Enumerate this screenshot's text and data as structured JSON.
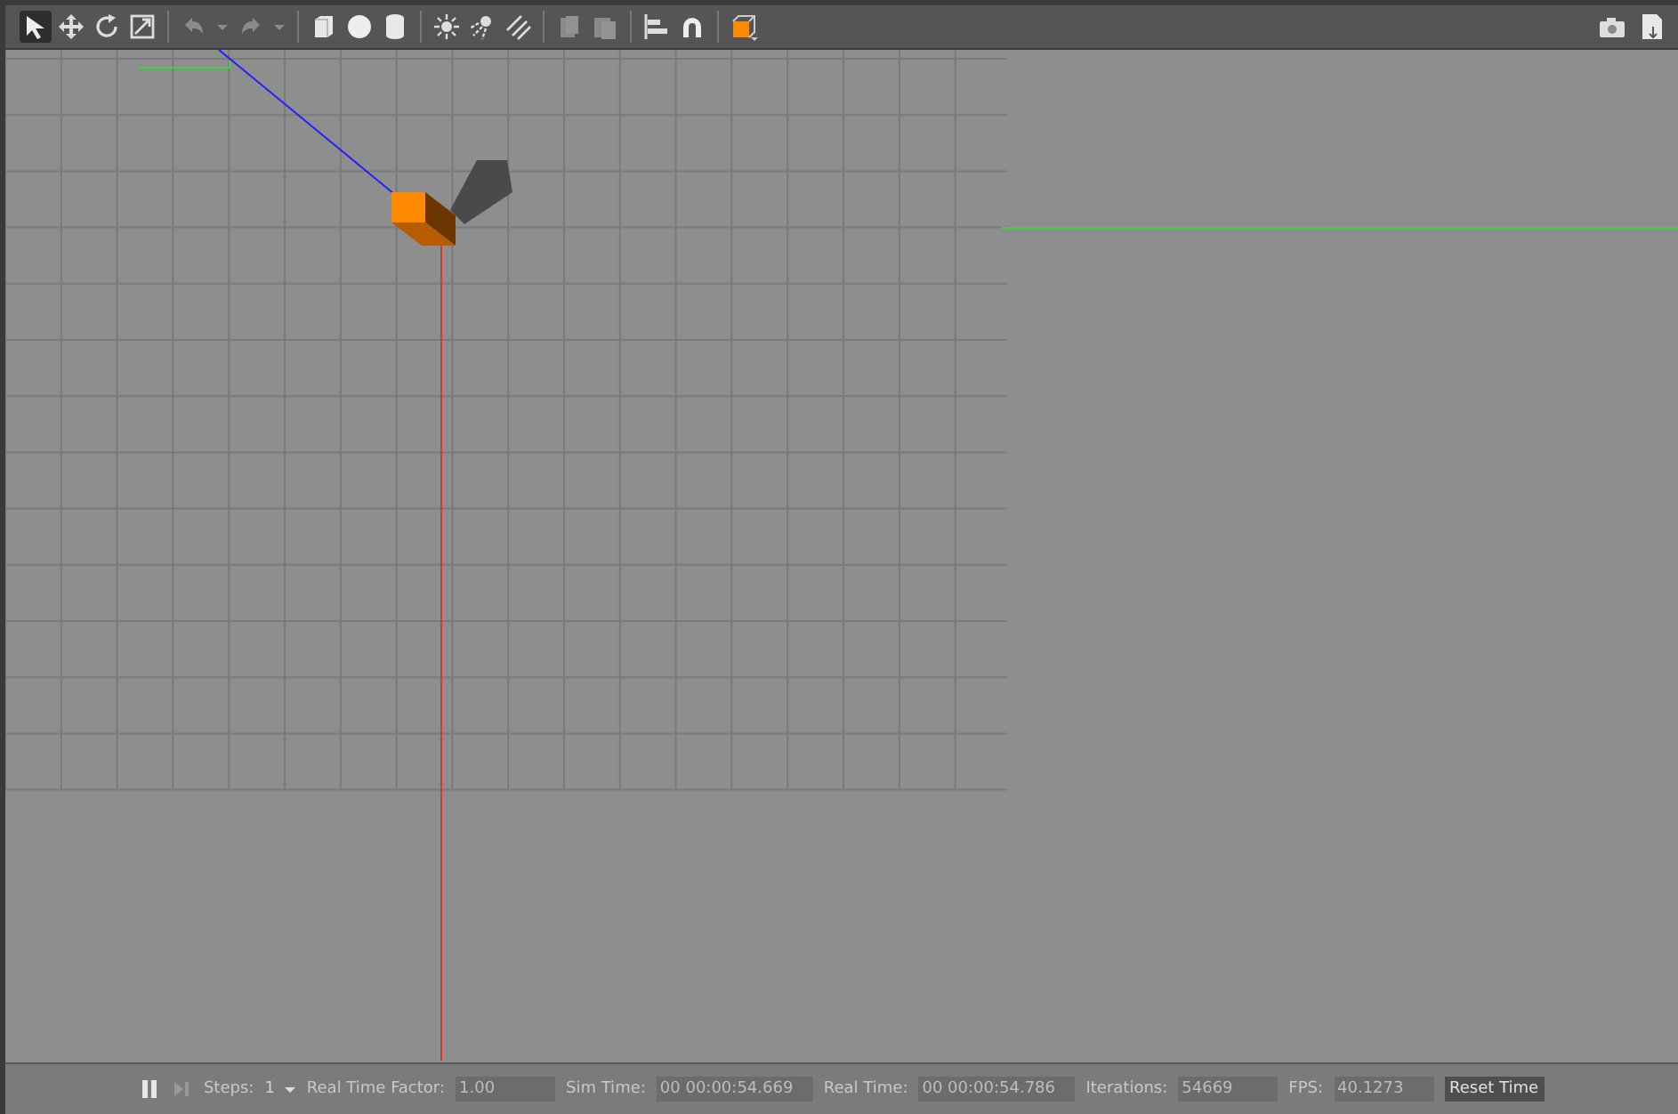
{
  "toolbar": {
    "tools": [
      {
        "kind": "select",
        "selected": true,
        "disabled": false
      },
      {
        "kind": "translate",
        "selected": false,
        "disabled": false
      },
      {
        "kind": "rotate",
        "selected": false,
        "disabled": false
      },
      {
        "kind": "scale",
        "selected": false,
        "disabled": false
      },
      {
        "kind": "sep"
      },
      {
        "kind": "undo",
        "selected": false,
        "disabled": true
      },
      {
        "kind": "caret",
        "selected": false,
        "disabled": true
      },
      {
        "kind": "redo",
        "selected": false,
        "disabled": true
      },
      {
        "kind": "caret",
        "selected": false,
        "disabled": true
      },
      {
        "kind": "sep"
      },
      {
        "kind": "box",
        "selected": false,
        "disabled": false
      },
      {
        "kind": "sphere",
        "selected": false,
        "disabled": false
      },
      {
        "kind": "cylinder",
        "selected": false,
        "disabled": false
      },
      {
        "kind": "sep"
      },
      {
        "kind": "pointlight",
        "selected": false,
        "disabled": false
      },
      {
        "kind": "spotlight",
        "selected": false,
        "disabled": false
      },
      {
        "kind": "dirlight",
        "selected": false,
        "disabled": false
      },
      {
        "kind": "sep"
      },
      {
        "kind": "copy",
        "selected": false,
        "disabled": true
      },
      {
        "kind": "paste",
        "selected": false,
        "disabled": true
      },
      {
        "kind": "sep"
      },
      {
        "kind": "align",
        "selected": false,
        "disabled": false
      },
      {
        "kind": "snap",
        "selected": false,
        "disabled": false
      },
      {
        "kind": "sep"
      },
      {
        "kind": "view",
        "selected": false,
        "disabled": false
      }
    ],
    "right_tools": [
      {
        "kind": "camera",
        "selected": false,
        "disabled": false
      },
      {
        "kind": "log",
        "selected": false,
        "disabled": false
      }
    ]
  },
  "status_bar": {
    "paused": false,
    "steps_label": "Steps:",
    "steps_value": "1",
    "fields": [
      {
        "label": "Real Time Factor:",
        "value": "1.00"
      },
      {
        "label": "Sim Time:",
        "value": "00 00:00:54.669"
      },
      {
        "label": "Real Time:",
        "value": "00 00:00:54.786"
      },
      {
        "label": "Iterations:",
        "value": "54669"
      },
      {
        "label": "FPS:",
        "value": "40.1273"
      }
    ],
    "reset_button": "Reset Time"
  }
}
